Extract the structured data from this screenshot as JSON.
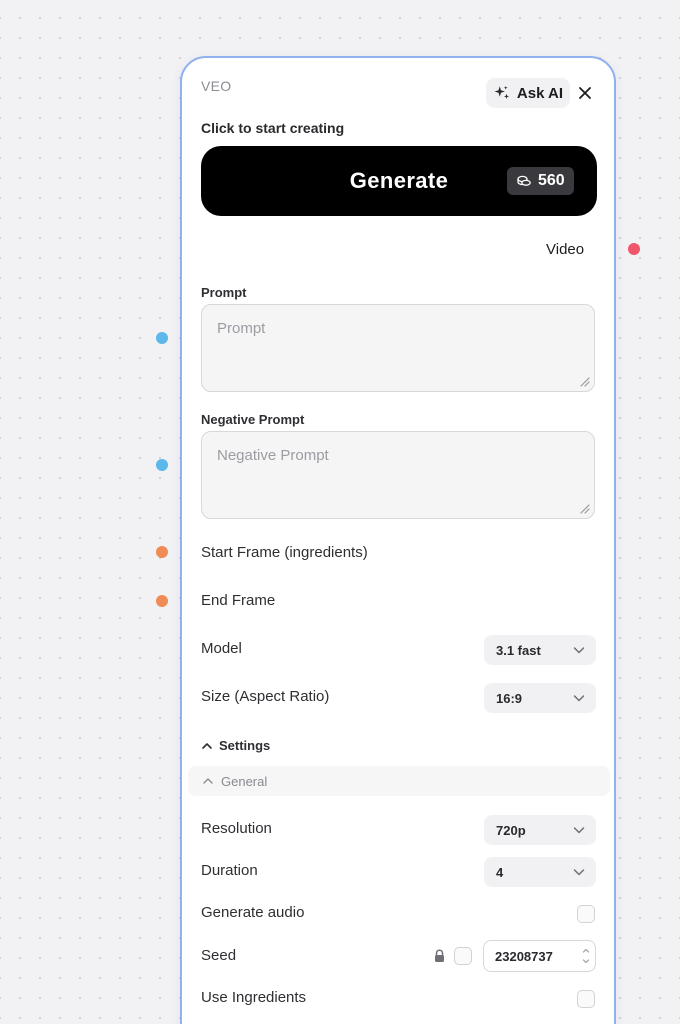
{
  "node": {
    "title": "VEO",
    "ask_ai_label": "Ask AI",
    "hint": "Click to start creating",
    "generate_label": "Generate",
    "cost": "560",
    "output_label": "Video"
  },
  "prompt": {
    "label": "Prompt",
    "placeholder": "Prompt",
    "value": ""
  },
  "negative_prompt": {
    "label": "Negative Prompt",
    "placeholder": "Negative Prompt",
    "value": ""
  },
  "inputs": {
    "start_frame_label": "Start Frame (ingredients)",
    "end_frame_label": "End Frame"
  },
  "model": {
    "label": "Model",
    "value": "3.1 fast"
  },
  "size": {
    "label": "Size (Aspect Ratio)",
    "value": "16:9"
  },
  "settings": {
    "label": "Settings",
    "general_label": "General",
    "resolution_label": "Resolution",
    "resolution_value": "720p",
    "duration_label": "Duration",
    "duration_value": "4",
    "generate_audio_label": "Generate audio",
    "seed_label": "Seed",
    "seed_value": "23208737",
    "use_ingredients_label": "Use Ingredients"
  },
  "icons": {
    "ask_ai": "sparkle-icon",
    "close": "close-icon",
    "cost": "coins-icon",
    "select": "chevron-down-icon",
    "collapse": "chevron-up-icon",
    "seed_lock": "lock-icon",
    "resize": "resize-grip-icon"
  },
  "colors": {
    "card_border": "#8fb1ee",
    "generate_bg": "#000000",
    "port_text": "#5cb7ea",
    "port_image": "#f08b55",
    "port_video": "#f0566b"
  }
}
